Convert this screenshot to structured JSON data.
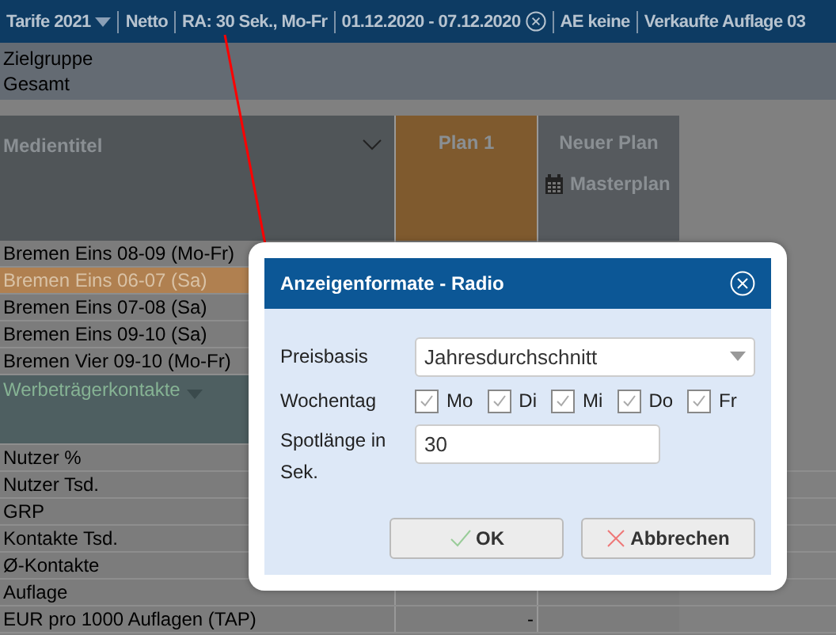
{
  "toolbar": {
    "items": [
      {
        "kind": "dropdown",
        "label": "Tarife 2021"
      },
      {
        "kind": "text",
        "label": "Netto"
      },
      {
        "kind": "text",
        "label": "RA: 30 Sek., Mo-Fr"
      },
      {
        "kind": "clearable",
        "label": "01.12.2020 - 07.12.2020"
      },
      {
        "kind": "text",
        "label": "AE keine"
      },
      {
        "kind": "text",
        "label": "Verkaufte Auflage 03"
      }
    ]
  },
  "target_group": {
    "label": "Zielgruppe",
    "value": "Gesamt"
  },
  "grid": {
    "title_column": "Medientitel",
    "plans": [
      {
        "label": "Plan 1",
        "selected": true
      },
      {
        "label": "Neuer Plan",
        "selected": false,
        "action": "Masterplan"
      }
    ],
    "media_rows": [
      {
        "label": "Bremen Eins 08-09 (Mo-Fr)",
        "selected": false
      },
      {
        "label": "Bremen Eins 06-07 (Sa)",
        "selected": true
      },
      {
        "label": "Bremen Eins 07-08 (Sa)",
        "selected": false
      },
      {
        "label": "Bremen Eins 09-10 (Sa)",
        "selected": false
      },
      {
        "label": "Bremen Vier 09-10 (Mo-Fr)",
        "selected": false
      }
    ],
    "section": "Werbeträgerkontakte",
    "metric_rows": [
      {
        "label": "Nutzer %"
      },
      {
        "label": "Nutzer Tsd."
      },
      {
        "label": "GRP"
      },
      {
        "label": "Kontakte Tsd."
      },
      {
        "label": "Ø-Kontakte"
      },
      {
        "label": "Auflage"
      },
      {
        "label": "EUR pro 1000 Auflagen (TAP)",
        "plan_value": "-"
      }
    ]
  },
  "dialog": {
    "title": "Anzeigenformate - Radio",
    "price_basis": {
      "label": "Preisbasis",
      "value": "Jahresdurchschnitt"
    },
    "weekday": {
      "label": "Wochentag",
      "days": [
        {
          "label": "Mo",
          "checked": true
        },
        {
          "label": "Di",
          "checked": true
        },
        {
          "label": "Mi",
          "checked": true
        },
        {
          "label": "Do",
          "checked": true
        },
        {
          "label": "Fr",
          "checked": true
        }
      ]
    },
    "spot_length": {
      "label": "Spotlänge in Sek.",
      "value": "30"
    },
    "buttons": [
      {
        "kind": "ok",
        "label": "OK"
      },
      {
        "kind": "cancel",
        "label": "Abbrechen"
      }
    ]
  }
}
